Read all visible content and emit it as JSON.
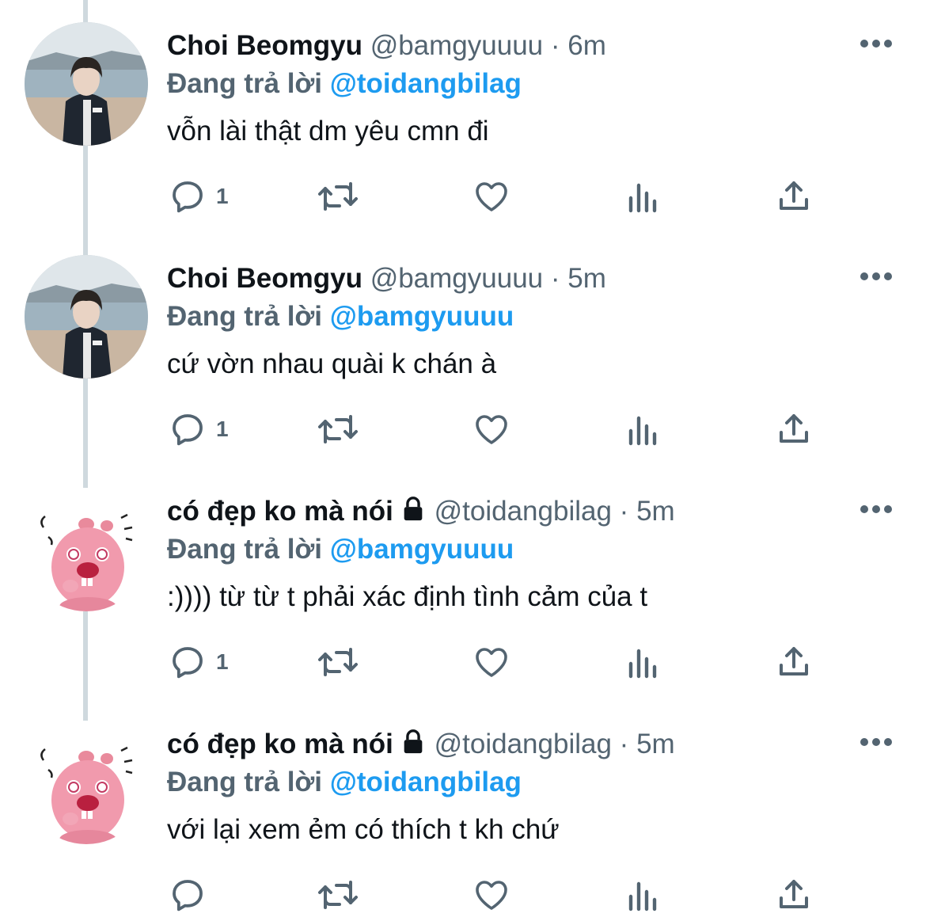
{
  "tweets": [
    {
      "name": "Choi Beomgyu",
      "handle": "@bamgyuuuu",
      "time": "6m",
      "separator": "·",
      "reply_prefix": "Đang trả lời",
      "reply_to": "@toidangbilag",
      "text": "vỗn lài thật dm yêu cmn đi",
      "reply_count": "1",
      "avatar": "photo-person-beach",
      "locked": false
    },
    {
      "name": "Choi Beomgyu",
      "handle": "@bamgyuuuu",
      "time": "5m",
      "separator": "·",
      "reply_prefix": "Đang trả lời",
      "reply_to": "@bamgyuuuu",
      "text": "cứ vờn nhau quài k chán à",
      "reply_count": "1",
      "avatar": "photo-person-beach",
      "locked": false
    },
    {
      "name": "có đẹp ko mà nói",
      "handle": "@toidangbilag",
      "time": "5m",
      "separator": "·",
      "reply_prefix": "Đang trả lời",
      "reply_to": "@bamgyuuuu",
      "text": ":)))) từ từ t phải xác định tình cảm của t",
      "reply_count": "1",
      "avatar": "pink-beaver-cartoon",
      "locked": true
    },
    {
      "name": "có đẹp ko mà nói",
      "handle": "@toidangbilag",
      "time": "5m",
      "separator": "·",
      "reply_prefix": "Đang trả lời",
      "reply_to": "@toidangbilag",
      "text": "với lại xem ẻm có thích t kh chứ",
      "reply_count": "",
      "avatar": "pink-beaver-cartoon",
      "locked": true
    }
  ],
  "icons": [
    "reply-icon",
    "retweet-icon",
    "like-icon",
    "views-icon",
    "share-icon",
    "more-icon",
    "lock-icon"
  ],
  "colors": {
    "text": "#0f1419",
    "secondary": "#536471",
    "accent": "#1d9bf0",
    "thread_line": "#cfd9de"
  }
}
